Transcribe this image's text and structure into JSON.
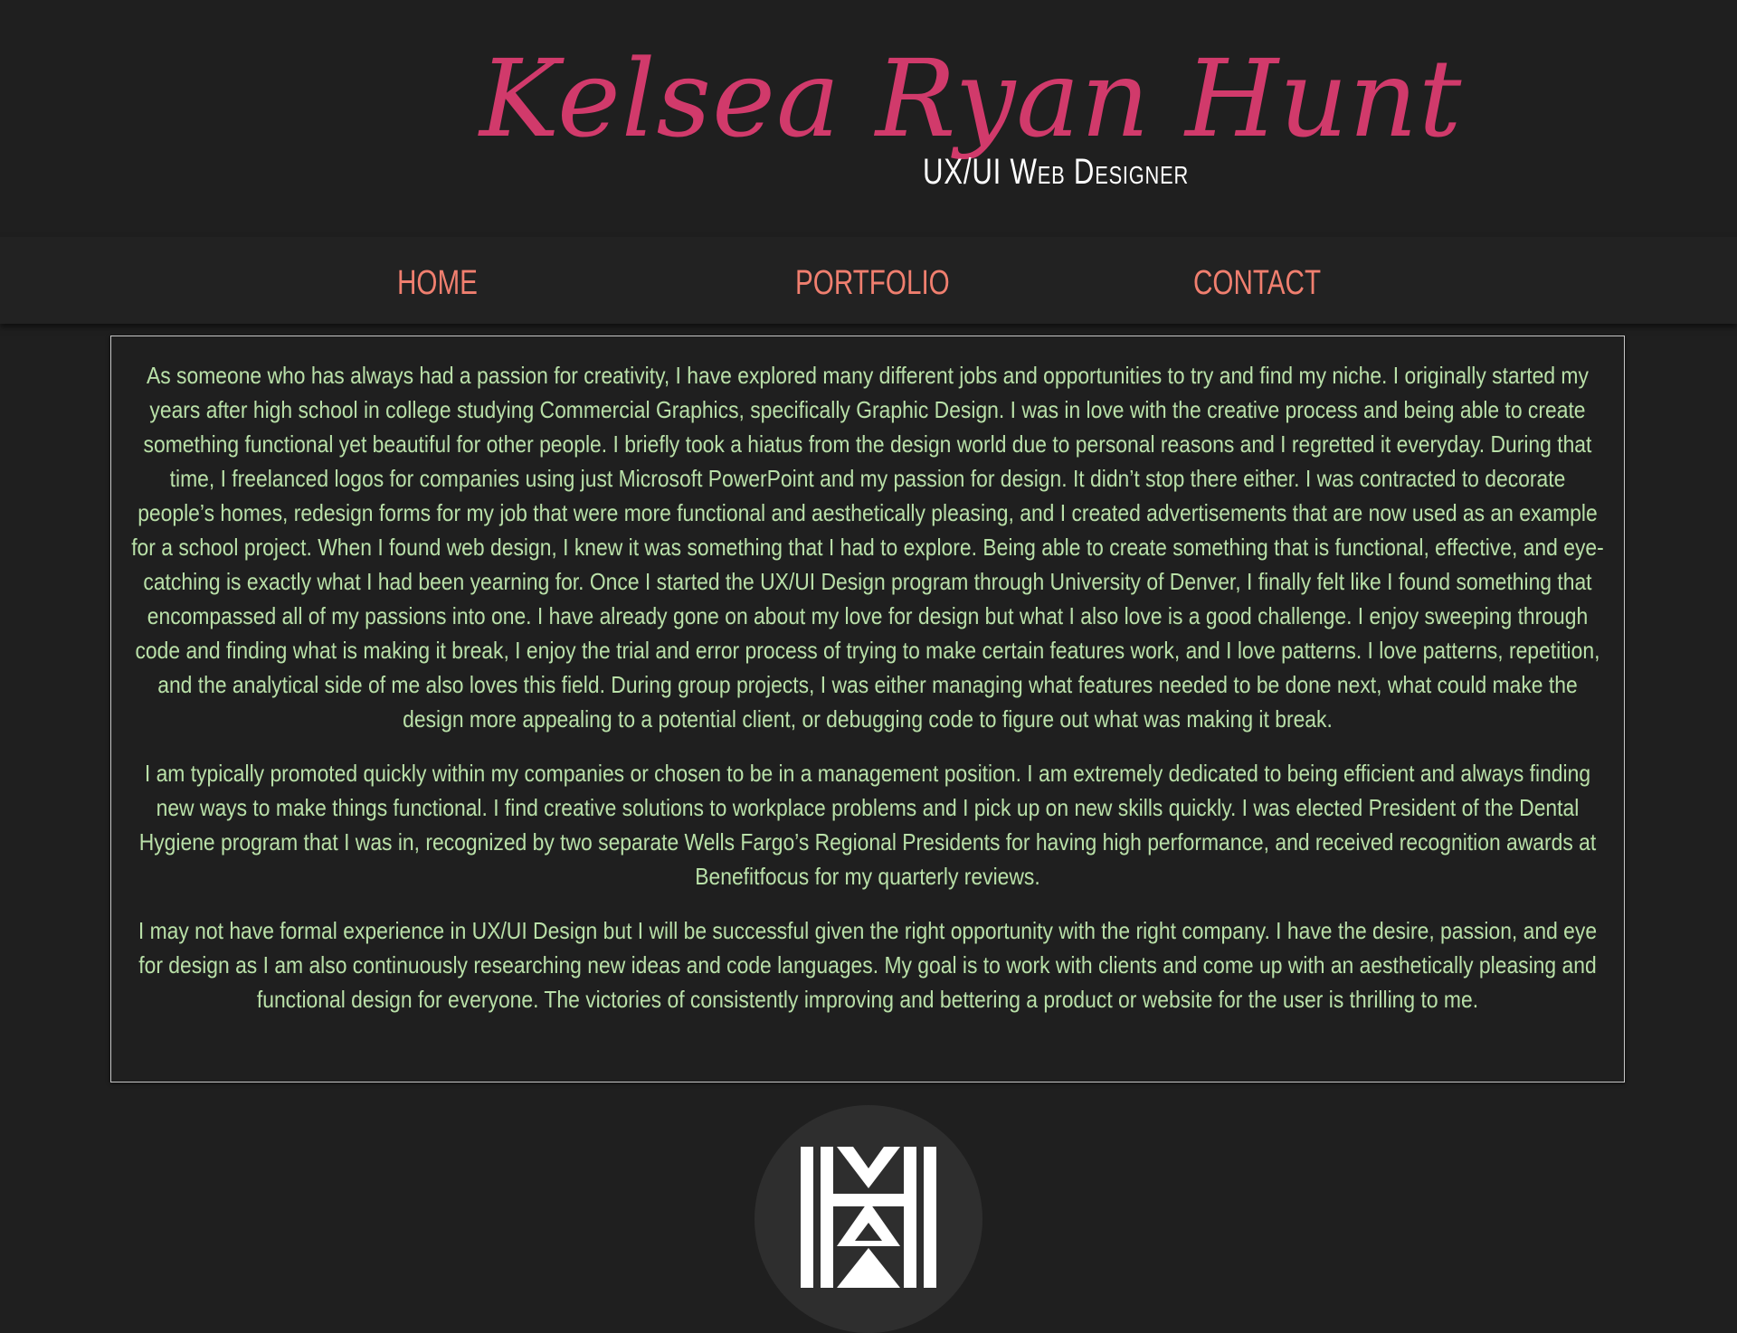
{
  "header": {
    "name": "Kelsea Ryan Hunt",
    "subtitle": "UX/UI Web Designer"
  },
  "nav": {
    "items": [
      {
        "label": "HOME"
      },
      {
        "label": "PORTFOLIO"
      },
      {
        "label": "CONTACT"
      }
    ]
  },
  "about": {
    "paragraphs": [
      "As someone who has always had a passion for creativity, I have explored many different jobs and opportunities to try and find my niche. I originally started my years after high school in college studying Commercial Graphics, specifically Graphic Design. I was in love with the creative process and being able to create something functional yet beautiful for other people. I briefly took a hiatus from the design world due to personal reasons and I regretted it everyday. During that time, I freelanced logos for companies using just Microsoft PowerPoint and my passion for design. It didn’t stop there either. I was contracted to decorate people’s homes, redesign forms for my job that were more functional and aesthetically pleasing, and I created advertisements that are now used as an example for a school project. When I found web design, I knew it was something that I had to explore. Being able to create something that is functional, effective, and eye-catching is exactly what I had been yearning for. Once I started the UX/UI Design program through University of Denver, I finally felt like I found something that encompassed all of my passions into one. I have already gone on about my love for design but what I also love is a good challenge. I enjoy sweeping through code and finding what is making it break, I enjoy the trial and error process of trying to make certain features work, and I love patterns. I love patterns, repetition, and the analytical side of me also loves this field. During group projects, I was either managing what features needed to be done next, what could make the design more appealing to a potential client, or debugging code to figure out what was making it break.",
      "I am typically promoted quickly within my companies or chosen to be in a management position. I am extremely dedicated to being efficient and always finding new ways to make things functional. I find creative solutions to workplace problems and I pick up on new skills quickly. I was elected President of the Dental Hygiene program that I was in, recognized by two separate Wells Fargo’s Regional Presidents for having high performance, and received recognition awards at Benefitfocus for my quarterly reviews.",
      "I may not have formal experience in UX/UI Design but I will be successful given the right opportunity with the right company. I have the desire, passion, and eye for design as I am also continuously researching new ideas and code languages. My goal is to work with clients and come up with an aesthetically pleasing and functional design for everyone. The victories of consistently improving and bettering a product or website for the user is thrilling to me."
    ]
  },
  "footer": {
    "logo_icon": "khr-monogram-logo-icon"
  },
  "colors": {
    "background": "#1f1f1f",
    "name_pink": "#d13a6b",
    "nav_coral": "#f07f6f",
    "body_green": "#b9e0a8",
    "subtitle_white": "#ffffff"
  }
}
